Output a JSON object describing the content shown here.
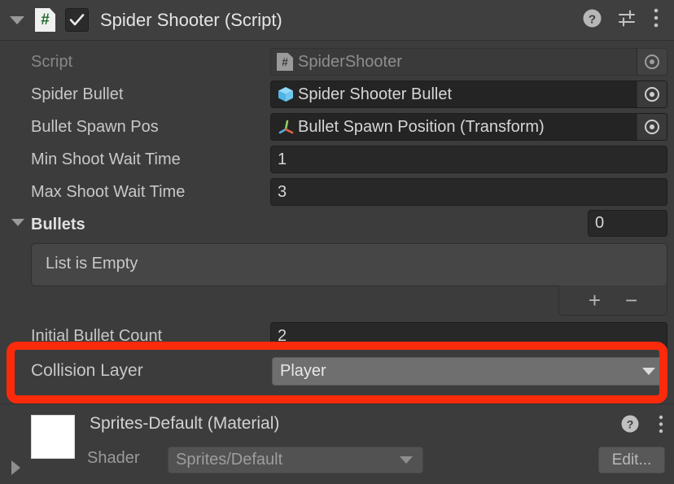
{
  "component": {
    "title": "Spider Shooter (Script)",
    "enabled": true,
    "expanded": true,
    "icons": {
      "foldout": "chevron-down-icon",
      "script": "csharp-script-icon",
      "help": "help-icon",
      "preset": "preset-sliders-icon",
      "menu": "kebab-menu-icon"
    }
  },
  "properties": [
    {
      "label": "Script",
      "type": "object",
      "value": "SpiderShooter",
      "icon": "csharp-script-icon",
      "disabled": true
    },
    {
      "label": "Spider Bullet",
      "type": "object",
      "value": "Spider Shooter Bullet",
      "icon": "prefab-cube-icon",
      "disabled": false
    },
    {
      "label": "Bullet Spawn Pos",
      "type": "object",
      "value": "Bullet Spawn Position (Transform)",
      "icon": "transform-axis-icon",
      "disabled": false
    },
    {
      "label": "Min Shoot Wait Time",
      "type": "number",
      "value": "1"
    },
    {
      "label": "Max Shoot Wait Time",
      "type": "number",
      "value": "3"
    }
  ],
  "list": {
    "label": "Bullets",
    "expanded": true,
    "size": "0",
    "empty_text": "List is Empty",
    "add_label": "+",
    "remove_label": "−"
  },
  "occluded_property": {
    "label": "Initial Bullet Count",
    "value": "2"
  },
  "highlighted_property": {
    "label": "Collision Layer",
    "type": "dropdown",
    "value": "Player",
    "highlight_color": "#fb2a0b"
  },
  "material": {
    "title": "Sprites-Default (Material)",
    "swatch_color": "#ffffff",
    "help_icon": "help-icon",
    "menu_icon": "kebab-menu-icon",
    "foldout_icon": "chevron-right-icon",
    "shader_label": "Shader",
    "shader_value": "Sprites/Default",
    "edit_label": "Edit..."
  },
  "theme": {
    "panel_bg": "#3c3c3c",
    "field_bg": "#282828",
    "list_bg": "#464646",
    "dropdown_bg": "#6f6f6f",
    "text": "#c8c8c8",
    "text_dim": "#8e8e8e",
    "accent_green": "#1f6b2e",
    "accent_blue": "#5ec3f0"
  }
}
